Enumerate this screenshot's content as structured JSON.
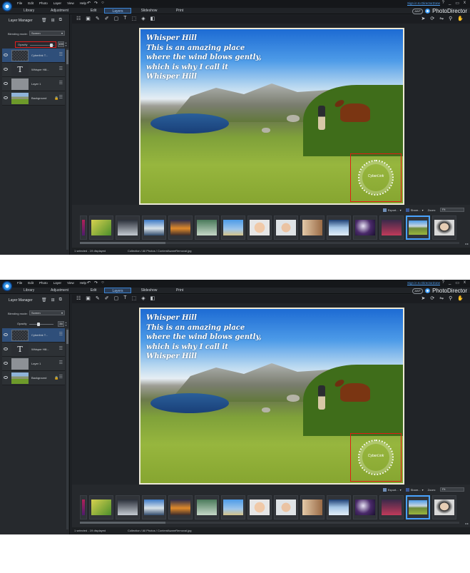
{
  "screens": [
    {
      "menu": [
        "File",
        "Edit",
        "Photo",
        "Layer",
        "View",
        "Help"
      ],
      "undo_icons": [
        "undo-icon",
        "redo-icon",
        "refresh-icon"
      ],
      "signin_text": "Sign in to DirectorZone",
      "window_controls": [
        "?",
        "_",
        "▭",
        "x"
      ],
      "mode_tabs": {
        "library": "Library",
        "adjustment": "Adjustment"
      },
      "tabs": [
        "Edit",
        "Layers",
        "Slideshow",
        "Print"
      ],
      "active_tab": "Layers",
      "brand": {
        "badge": "AWT",
        "name": "PhotoDirector"
      },
      "layer_manager": {
        "title": "Layer Manager",
        "blending_label": "Blending mode:",
        "blending_value": "Screen",
        "opacity_label": "Opacity",
        "opacity_value": "100",
        "opacity_level_pct": 88,
        "layers": [
          {
            "name": "Cyberlink T...",
            "thumb": "checker",
            "selected": true,
            "locked": false
          },
          {
            "name": "Whisper Hill...",
            "thumb": "text",
            "selected": false,
            "locked": false
          },
          {
            "name": "Layer 1",
            "thumb": "gray",
            "selected": false,
            "locked": false
          },
          {
            "name": "Background",
            "thumb": "photo",
            "selected": false,
            "locked": true
          }
        ],
        "save_label": "Save to",
        "clear_label": "Clear"
      },
      "photo_text_lines": [
        "Whisper Hill",
        "This is an amazing place",
        "where the wind blows gently,",
        "which is why I call it",
        "Whisper Hill"
      ],
      "watermark_text": "CyberLink",
      "film_tools": {
        "export": "Export...",
        "share": "Share...",
        "zoom_label": "Zoom:",
        "zoom_value": "Fit"
      },
      "status_left": "1 selected - 19 displayed",
      "status_path": "Collection / All Photos / ContentAwareRemoval.jpg",
      "highlight_opacity": true
    },
    {
      "menu": [
        "File",
        "Edit",
        "Photo",
        "Layer",
        "View",
        "Help"
      ],
      "undo_icons": [
        "undo-icon",
        "redo-icon",
        "refresh-icon"
      ],
      "signin_text": "Sign in to DirectorZone",
      "window_controls": [
        "?",
        "_",
        "▭",
        "x"
      ],
      "mode_tabs": {
        "library": "Library",
        "adjustment": "Adjustment"
      },
      "tabs": [
        "Edit",
        "Layers",
        "Slideshow",
        "Print"
      ],
      "active_tab": "Layers",
      "brand": {
        "badge": "AWT",
        "name": "PhotoDirector"
      },
      "layer_manager": {
        "title": "Layer Manager",
        "blending_label": "Blending mode:",
        "blending_value": "Screen",
        "opacity_label": "Opacity",
        "opacity_value": "34",
        "opacity_level_pct": 34,
        "layers": [
          {
            "name": "Cyberlink T...",
            "thumb": "checker",
            "selected": true,
            "locked": false
          },
          {
            "name": "Whisper Hill...",
            "thumb": "text",
            "selected": false,
            "locked": false
          },
          {
            "name": "Layer 1",
            "thumb": "gray",
            "selected": false,
            "locked": false
          },
          {
            "name": "Background",
            "thumb": "photo",
            "selected": false,
            "locked": true
          }
        ],
        "save_label": "Save to",
        "clear_label": "Clear"
      },
      "photo_text_lines": [
        "Whisper Hill",
        "This is an amazing place",
        "where the wind blows gently,",
        "which is why I call it",
        "Whisper Hill"
      ],
      "watermark_text": "CyberLink",
      "film_tools": {
        "export": "Export...",
        "share": "Share...",
        "zoom_label": "Zoom:",
        "zoom_value": "Fit"
      },
      "status_left": "1 selected - 19 displayed",
      "status_path": "Collection / All Photos / ContentAwareRemoval.jpg",
      "highlight_opacity": false
    }
  ],
  "colors": {
    "accent": "#3b85d6",
    "highlight_box": "#e01e1e",
    "panel_bg": "#26292d",
    "selected_layer": "#2f4f7a"
  }
}
